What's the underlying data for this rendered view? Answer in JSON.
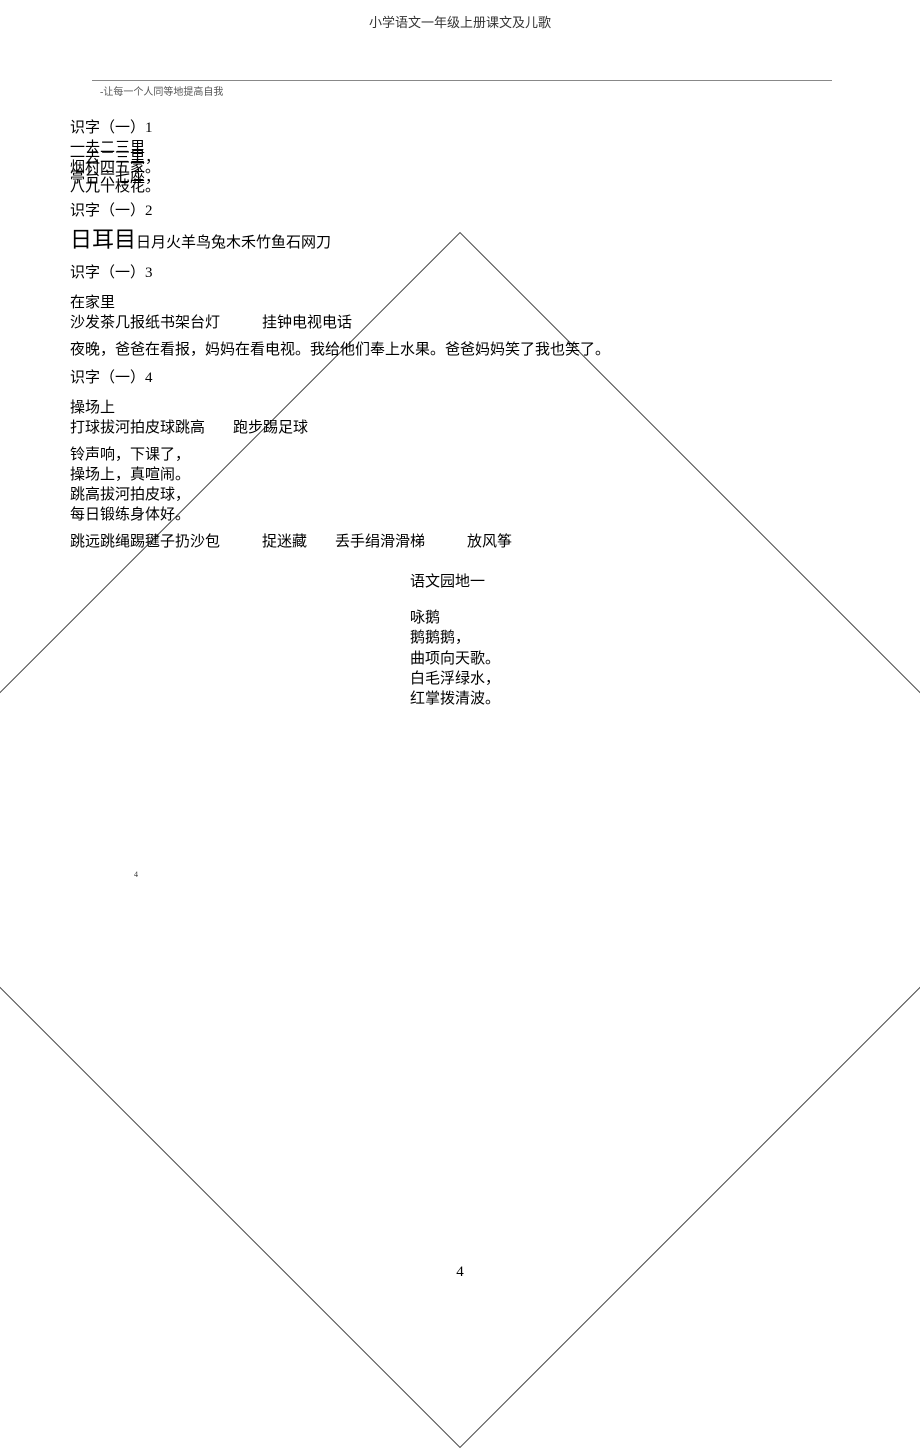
{
  "header": {
    "pageTitle": "小学语文一年级上册课文及儿歌",
    "strapline": "-让每一个人同等地提高自我"
  },
  "sections": {
    "s1": {
      "heading": "识字（一）1",
      "lines": [
        "一去二三里",
        "一去二三里，",
        "烟村四五家。",
        "亭台六七座，",
        "八九十枝花。"
      ]
    },
    "s2": {
      "heading": "识字（一）2",
      "bigChars": "日耳目",
      "restChars": "日月火羊鸟兔木禾竹鱼石网刀"
    },
    "s3": {
      "heading": "识字（一）3",
      "title": "在家里",
      "wordsA": "沙发茶几报纸书架台灯",
      "wordsB": "挂钟电视电话",
      "para": "夜晚，爸爸在看报，妈妈在看电视。我给他们奉上水果。爸爸妈妈笑了我也笑了。"
    },
    "s4": {
      "heading": "识字（一）4",
      "title": "操场上",
      "wordsA": "打球拔河拍皮球跳高",
      "wordsB": "跑步踢足球",
      "poem": [
        "铃声响，下课了，",
        "操场上，真喧闹。",
        "跳高拔河拍皮球，",
        "每日锻练身体好。"
      ],
      "extraA": "跳远跳绳踢毽子扔沙包",
      "extraB": "捉迷藏",
      "extraC": "丢手绢滑滑梯",
      "extraD": "放风筝"
    },
    "garden": {
      "title": "语文园地一",
      "poemTitle": "咏鹅",
      "lines": [
        "鹅鹅鹅，",
        "曲项向天歌。",
        "白毛浮绿水，",
        "红掌拨清波。"
      ]
    }
  },
  "pageNumbers": {
    "small": "4",
    "bottom": "4"
  }
}
